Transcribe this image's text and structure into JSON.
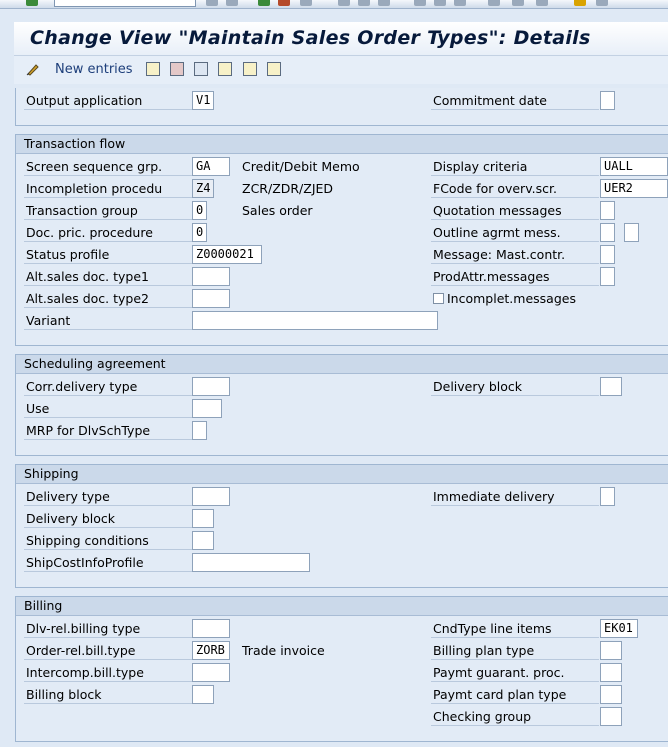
{
  "title": "Change View \"Maintain Sales Order Types\": Details",
  "toolbar": {
    "new_entries": "New entries"
  },
  "header": {
    "output_application": {
      "label": "Output application",
      "value": "V1"
    },
    "commitment_date": {
      "label": "Commitment  date",
      "value": ""
    }
  },
  "transaction_flow": {
    "title": "Transaction flow",
    "screen_sequence_grp": {
      "label": "Screen sequence grp.",
      "value": "GA",
      "text": "Credit/Debit Memo"
    },
    "incompletion_procedure": {
      "label": "Incompletion procedu",
      "value": "Z4",
      "text": "ZCR/ZDR/ZJED"
    },
    "transaction_group": {
      "label": "Transaction group",
      "value": "0",
      "text": "Sales order"
    },
    "doc_pric_procedure": {
      "label": "Doc. pric. procedure",
      "value": "0"
    },
    "status_profile": {
      "label": "Status profile",
      "value": "Z0000021"
    },
    "alt_sales_doc_type1": {
      "label": "Alt.sales doc. type1",
      "value": ""
    },
    "alt_sales_doc_type2": {
      "label": "Alt.sales doc. type2",
      "value": ""
    },
    "variant": {
      "label": "Variant",
      "value": ""
    },
    "display_criteria": {
      "label": "Display criteria",
      "value": "UALL"
    },
    "fcode_overv_scr": {
      "label": "FCode for overv.scr.",
      "value": "UER2"
    },
    "quotation_messages": {
      "label": "Quotation messages",
      "value": ""
    },
    "outline_agrmt_mess": {
      "label": "Outline agrmt mess.",
      "value": ""
    },
    "message_mast_contr": {
      "label": "Message: Mast.contr.",
      "value": ""
    },
    "prodattr_messages": {
      "label": "ProdAttr.messages",
      "value": ""
    },
    "incomplet_messages": {
      "label": "Incomplet.messages"
    }
  },
  "scheduling_agreement": {
    "title": "Scheduling agreement",
    "corr_delivery_type": {
      "label": "Corr.delivery type",
      "value": ""
    },
    "use": {
      "label": "Use",
      "value": ""
    },
    "mrp_for_dlvschtype": {
      "label": "MRP for DlvSchType",
      "value": ""
    },
    "delivery_block": {
      "label": "Delivery block",
      "value": ""
    }
  },
  "shipping": {
    "title": "Shipping",
    "delivery_type": {
      "label": "Delivery type",
      "value": ""
    },
    "delivery_block": {
      "label": "Delivery block",
      "value": ""
    },
    "shipping_conditions": {
      "label": "Shipping conditions",
      "value": ""
    },
    "shipcostinfoprofile": {
      "label": "ShipCostInfoProfile",
      "value": ""
    },
    "immediate_delivery": {
      "label": "Immediate delivery",
      "value": ""
    }
  },
  "billing": {
    "title": "Billing",
    "dlv_rel_billing_type": {
      "label": "Dlv-rel.billing type",
      "value": ""
    },
    "order_rel_bill_type": {
      "label": "Order-rel.bill.type",
      "value": "ZORB",
      "text": "Trade invoice"
    },
    "intercomp_bill_type": {
      "label": "Intercomp.bill.type",
      "value": ""
    },
    "billing_block": {
      "label": "Billing block",
      "value": ""
    },
    "cndtype_line_items": {
      "label": "CndType line items",
      "value": "EK01"
    },
    "billing_plan_type": {
      "label": "Billing plan type",
      "value": ""
    },
    "paymt_guarant_proc": {
      "label": "Paymt guarant. proc.",
      "value": ""
    },
    "paymt_card_plan_type": {
      "label": "Paymt card plan type",
      "value": ""
    },
    "checking_group": {
      "label": "Checking group",
      "value": ""
    }
  }
}
